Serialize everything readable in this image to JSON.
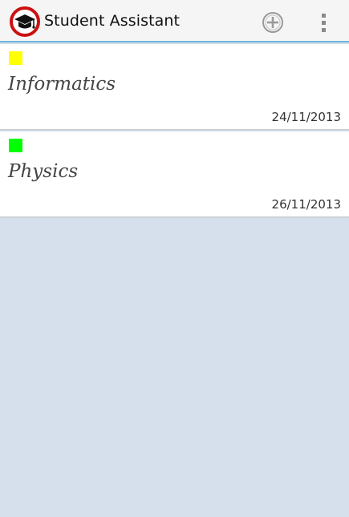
{
  "app": {
    "title": "Student Assistant",
    "icon": "graduation-cap-icon",
    "accent_color": "#6cb8db"
  },
  "toolbar": {
    "add_icon": "add-circle-icon",
    "overflow_icon": "overflow-menu-icon"
  },
  "subjects": [
    {
      "name": "Informatics",
      "date": "24/11/2013",
      "color": "#ffff00"
    },
    {
      "name": "Physics",
      "date": "26/11/2013",
      "color": "#00ff00"
    }
  ]
}
